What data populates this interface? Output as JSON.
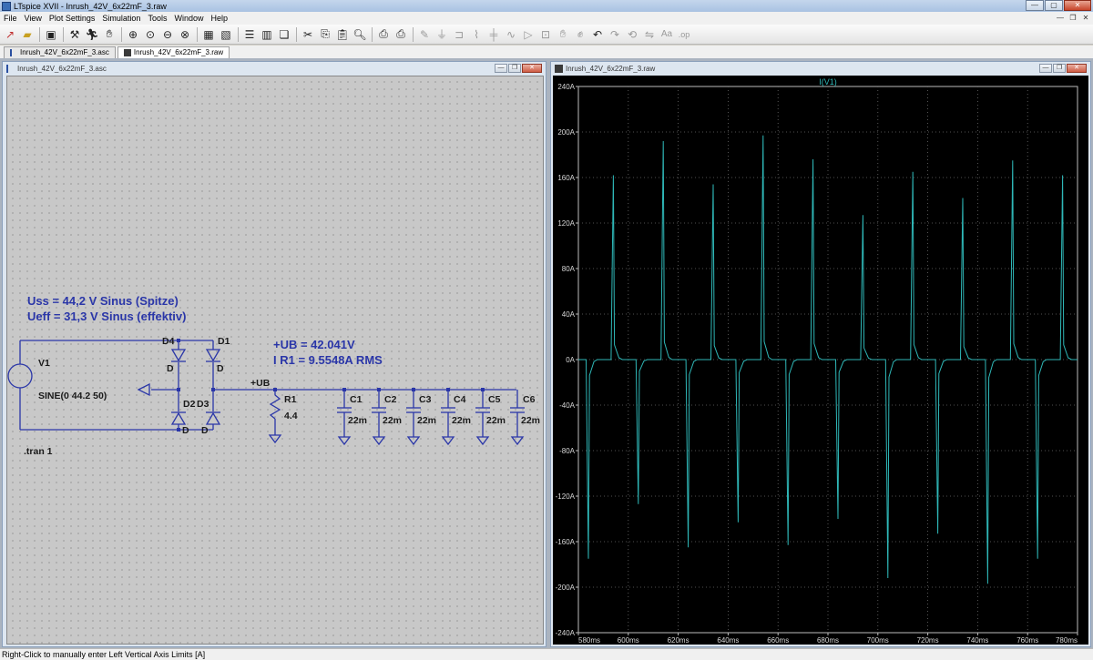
{
  "window": {
    "title": "LTspice XVII - Inrush_42V_6x22mF_3.raw"
  },
  "menu": [
    "File",
    "View",
    "Plot Settings",
    "Simulation",
    "Tools",
    "Window",
    "Help"
  ],
  "tabs": [
    {
      "label": "Inrush_42V_6x22mF_3.asc",
      "active": false
    },
    {
      "label": "Inrush_42V_6x22mF_3.raw",
      "active": true
    }
  ],
  "schematic": {
    "window_title": "Inrush_42V_6x22mF_3.asc",
    "annotations": {
      "uss": "Uss  = 44,2 V Sinus (Spitze)",
      "ueff": "Ueff = 31,3 V Sinus (effektiv)",
      "ub": "+UB = 42.041V",
      "ir1": "I R1 = 9.5548A RMS",
      "tran": ".tran 1"
    },
    "source": {
      "name": "V1",
      "value": "SINE(0 44.2 50)"
    },
    "diodes": [
      {
        "name": "D4",
        "model": "D"
      },
      {
        "name": "D1",
        "model": "D"
      },
      {
        "name": "D2",
        "model": "D"
      },
      {
        "name": "D3",
        "model": "D"
      }
    ],
    "net_label": "+UB",
    "resistor": {
      "name": "R1",
      "value": "4.4"
    },
    "capacitors": [
      {
        "name": "C1",
        "value": "22m"
      },
      {
        "name": "C2",
        "value": "22m"
      },
      {
        "name": "C3",
        "value": "22m"
      },
      {
        "name": "C4",
        "value": "22m"
      },
      {
        "name": "C5",
        "value": "22m"
      },
      {
        "name": "C6",
        "value": "22m"
      }
    ]
  },
  "waveform": {
    "window_title": "Inrush_42V_6x22mF_3.raw",
    "trace_color": "#2fb8b8"
  },
  "chart_data": {
    "type": "line",
    "title": "I(V1)",
    "xlabel": "",
    "ylabel": "",
    "xlim": [
      580,
      780
    ],
    "ylim": [
      -240,
      240
    ],
    "x_ticks": [
      "580ms",
      "600ms",
      "620ms",
      "640ms",
      "660ms",
      "680ms",
      "700ms",
      "720ms",
      "740ms",
      "760ms",
      "780ms"
    ],
    "y_ticks": [
      "240A",
      "200A",
      "160A",
      "120A",
      "80A",
      "40A",
      "0A",
      "-40A",
      "-80A",
      "-120A",
      "-160A",
      "-200A",
      "-240A"
    ],
    "grid": true,
    "series": [
      {
        "name": "I(V1)",
        "pulses": [
          {
            "t": 584,
            "peak": -175
          },
          {
            "t": 594,
            "peak": 162
          },
          {
            "t": 604,
            "peak": -127
          },
          {
            "t": 614,
            "peak": 192
          },
          {
            "t": 624,
            "peak": -165
          },
          {
            "t": 634,
            "peak": 154
          },
          {
            "t": 644,
            "peak": -143
          },
          {
            "t": 654,
            "peak": 197
          },
          {
            "t": 664,
            "peak": -163
          },
          {
            "t": 674,
            "peak": 176
          },
          {
            "t": 684,
            "peak": -140
          },
          {
            "t": 694,
            "peak": 127
          },
          {
            "t": 704,
            "peak": -192
          },
          {
            "t": 714,
            "peak": 165
          },
          {
            "t": 724,
            "peak": -153
          },
          {
            "t": 734,
            "peak": 142
          },
          {
            "t": 744,
            "peak": -197
          },
          {
            "t": 754,
            "peak": 175
          },
          {
            "t": 764,
            "peak": -175
          },
          {
            "t": 774,
            "peak": 162
          }
        ]
      }
    ]
  },
  "statusbar": {
    "text": "Right-Click to manually enter Left Vertical Axis Limits [A]"
  }
}
